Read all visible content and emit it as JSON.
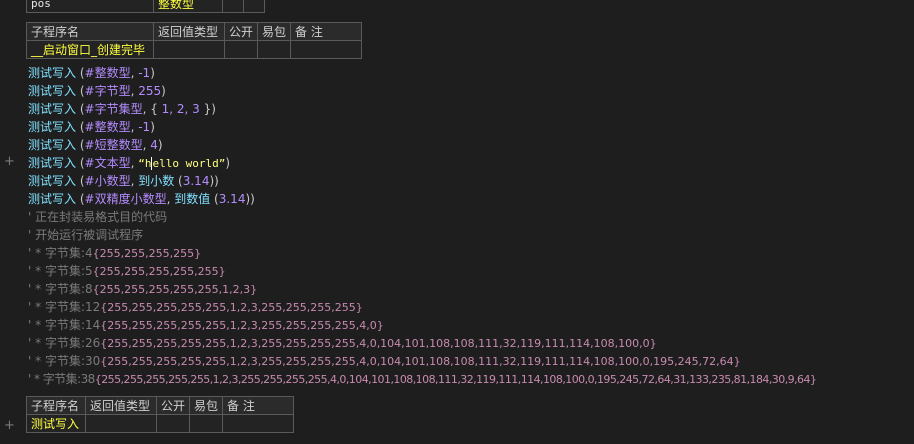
{
  "var_table": {
    "name": "pos",
    "type": "整数型"
  },
  "sub1": {
    "headers": [
      "子程序名",
      "返回值类型",
      "公开",
      "易包",
      "备 注"
    ],
    "name": "__启动窗口_创建完毕"
  },
  "code_lines": [
    {
      "cmd": "测试写入",
      "open": " (",
      "arg1": "#整数型",
      "sep": ", ",
      "arg2": "-1",
      "close": ")"
    },
    {
      "cmd": "测试写入",
      "open": " (",
      "arg1": "#字节型",
      "sep": ", ",
      "arg2": "255",
      "close": ")"
    },
    {
      "cmd": "测试写入",
      "open": " (",
      "arg1": "#字节集型",
      "sep": ", { ",
      "arg2": "1, 2, 3",
      "close": " })"
    },
    {
      "cmd": "测试写入",
      "open": " (",
      "arg1": "#整数型",
      "sep": ", ",
      "arg2": "-1",
      "close": ")"
    },
    {
      "cmd": "测试写入",
      "open": " (",
      "arg1": "#短整数型",
      "sep": ", ",
      "arg2": "4",
      "close": ")"
    },
    {
      "cmd": "测试写入",
      "open": " (",
      "arg1": "#文本型",
      "sep": ", ",
      "str_a": "“h",
      "str_b": "ello world”",
      "close": ")"
    },
    {
      "cmd": "测试写入",
      "open": " (",
      "arg1": "#小数型",
      "sep": ", ",
      "fn": "到小数",
      "fnopen": " (",
      "arg2": "3.14",
      "close": "))"
    },
    {
      "cmd": "测试写入",
      "open": " (",
      "arg1": "#双精度小数型",
      "sep": ", ",
      "fn": "到数值",
      "fnopen": " (",
      "arg2": "3.14",
      "close": "))"
    }
  ],
  "comments": [
    "正在封装易格式目的代码",
    "开始运行被调试程序"
  ],
  "output_lines": [
    {
      "label": "* 字节集:4",
      "value": "{255,255,255,255}"
    },
    {
      "label": "* 字节集:5",
      "value": "{255,255,255,255,255}"
    },
    {
      "label": "* 字节集:8",
      "value": "{255,255,255,255,255,1,2,3}"
    },
    {
      "label": "* 字节集:12",
      "value": "{255,255,255,255,255,1,2,3,255,255,255,255}"
    },
    {
      "label": "* 字节集:14",
      "value": "{255,255,255,255,255,1,2,3,255,255,255,255,4,0}"
    },
    {
      "label": "* 字节集:26",
      "value": "{255,255,255,255,255,1,2,3,255,255,255,255,4,0,104,101,108,108,111,32,119,111,114,108,100,0}"
    },
    {
      "label": "* 字节集:30",
      "value": "{255,255,255,255,255,1,2,3,255,255,255,255,4,0,104,101,108,108,111,32,119,111,114,108,100,0,195,245,72,64}"
    },
    {
      "label": "* 字节集:38",
      "value": "{255,255,255,255,255,1,2,3,255,255,255,255,4,0,104,101,108,108,111,32,119,111,114,108,100,0,195,245,72,64,31,133,235,81,184,30,9,64}"
    }
  ],
  "comment_mark": "'",
  "plus_sign": "+",
  "sub2": {
    "headers": [
      "子程序名",
      "返回值类型",
      "公开",
      "易包",
      "备 注"
    ],
    "name": "测试写入"
  },
  "colors": {
    "background": "#1e1e1e",
    "command": "#80e0ff",
    "constant": "#b48cff",
    "sub_name": "#ffff40",
    "comment": "#7a7a7a",
    "comment_value": "#c88ab0"
  }
}
